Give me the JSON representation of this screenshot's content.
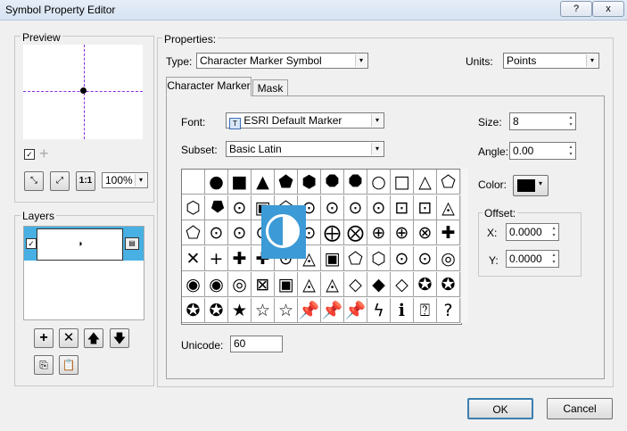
{
  "window": {
    "title": "Symbol Property Editor",
    "help_label": "?",
    "close_label": "x"
  },
  "preview": {
    "label": "Preview",
    "zoom_value": "100%",
    "show_crosshair_checked": true,
    "add_glyph": "+"
  },
  "layers": {
    "label": "Layers",
    "layer_checked": true,
    "layer_glyph": "◑"
  },
  "properties": {
    "label": "Properties:",
    "type_label": "Type:",
    "type_value": "Character Marker Symbol",
    "units_label": "Units:",
    "units_value": "Points",
    "tabs": [
      "Character Marker",
      "Mask"
    ],
    "font_label": "Font:",
    "font_value": "ESRI Default Marker",
    "subset_label": "Subset:",
    "subset_value": "Basic Latin",
    "size_label": "Size:",
    "size_value": "8",
    "angle_label": "Angle:",
    "angle_value": "0.00",
    "color_label": "Color:",
    "color_value": "#000000",
    "offset_label": "Offset:",
    "x_label": "X:",
    "x_value": "0.0000",
    "y_label": "Y:",
    "y_value": "0.0000",
    "unicode_label": "Unicode:",
    "unicode_value": "60",
    "magnified_glyph": "◑"
  },
  "glyphs": [
    [
      "",
      "●",
      "■",
      "▲",
      "⬟",
      "⬢",
      "⯃",
      "⯃",
      "○",
      "□",
      "△",
      "⬠"
    ],
    [
      "⬡",
      "⯂",
      "⊙",
      "▣",
      "⬠",
      "⊙",
      "⊙",
      "⊙",
      "⊙",
      "⊡",
      "⊡",
      "◬"
    ],
    [
      "⬠",
      "⊙",
      "⊙",
      "⊙",
      "⊙",
      "⊙",
      "⨁",
      "⨂",
      "⊕",
      "⊕",
      "⊗",
      "✚"
    ],
    [
      "✕",
      "+",
      "✚",
      "✚",
      "⊙",
      "◬",
      "▣",
      "⬠",
      "⬡",
      "⊙",
      "⊙",
      "◎"
    ],
    [
      "◉",
      "◉",
      "◎",
      "⊠",
      "▣",
      "◬",
      "◬",
      "◇",
      "◆",
      "◇",
      "✪",
      "✪"
    ],
    [
      "✪",
      "✪",
      "★",
      "☆",
      "☆",
      "📌",
      "📌",
      "📌",
      "ϟ",
      "ℹ",
      "⍰",
      "?"
    ]
  ],
  "buttons": {
    "ok": "OK",
    "cancel": "Cancel"
  }
}
